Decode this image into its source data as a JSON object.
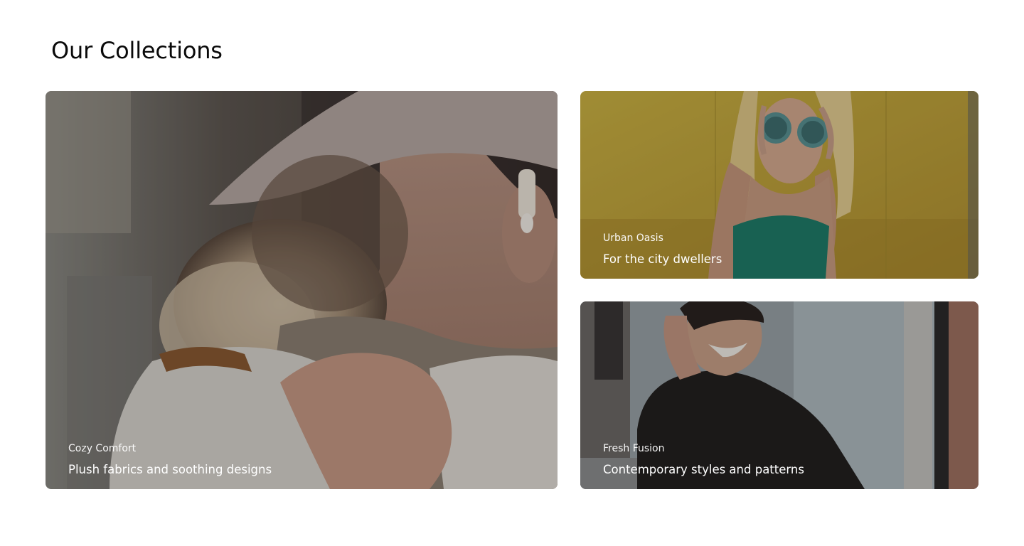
{
  "section": {
    "title": "Our Collections"
  },
  "collections": [
    {
      "name": "Cozy Comfort",
      "tagline": "Plush fabrics and soothing designs",
      "image": "woman-beret-sweater-photo"
    },
    {
      "name": "Urban Oasis",
      "tagline": "For the city dwellers",
      "image": "woman-sunglasses-yellow-wall-photo"
    },
    {
      "name": "Fresh Fusion",
      "tagline": "Contemporary styles and patterns",
      "image": "man-black-coat-laughing-photo"
    }
  ]
}
